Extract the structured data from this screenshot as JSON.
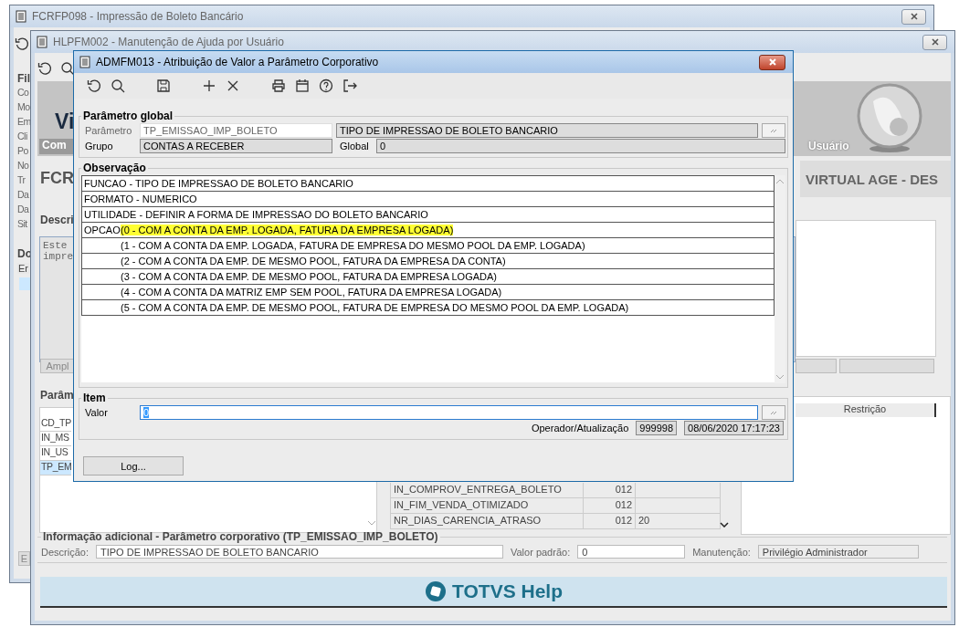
{
  "back_window": {
    "title": "FCRFP098 - Impressão de Boleto Bancário",
    "filter_group": "Fil",
    "filter_labels": [
      "Co",
      "Mo",
      "Em",
      "Cli",
      "Po",
      "No",
      "Tr",
      "Da",
      "Da",
      "Sit"
    ],
    "doc_group": "Do",
    "doc_column": "Er",
    "bottom_button": "E"
  },
  "help_window": {
    "title": "HLPFM002 - Manutenção de Ajuda por Usuário",
    "banner_text": "Vi",
    "banner_tab": "Com",
    "banner_user": "Usuário",
    "heading": "FCR",
    "company": "VIRTUAL AGE - DES",
    "description_group": "Descri",
    "description_lines": [
      "Este",
      "impre"
    ],
    "expand_button": "Ampl",
    "params_group": "Parâm",
    "param_rows": [
      {
        "name": "CD_TP",
        "selected": false
      },
      {
        "name": "IN_MS",
        "selected": false
      },
      {
        "name": "IN_US",
        "selected": false
      },
      {
        "name": "TP_EM",
        "selected": true
      }
    ],
    "table_rows": [
      {
        "name": "IN_COMPROV_ENTREGA_BOLETO",
        "code": "012"
      },
      {
        "name": "IN_FIM_VENDA_OTIMIZADO",
        "code": "012"
      },
      {
        "name": "NR_DIAS_CARENCIA_ATRASO",
        "code": "012",
        "value": "20"
      }
    ],
    "restriction_column": "Restrição",
    "info_group": "Informação adicional - Parâmetro corporativo (TP_EMISSAO_IMP_BOLETO)",
    "description_label": "Descrição:",
    "description_value": "TIPO DE IMPRESSAO DE BOLETO BANCARIO",
    "default_label": "Valor padrão:",
    "default_value": "0",
    "maintenance_label": "Manutenção:",
    "maintenance_value": "Privilégio Administrador",
    "help_banner": "TOTVS Help"
  },
  "dialog": {
    "title": "ADMFM013 - Atribuição de Valor a Parâmetro Corporativo",
    "global_group": "Parâmetro global",
    "parameter_label": "Parâmetro",
    "parameter_value": "TP_EMISSAO_IMP_BOLETO",
    "parameter_description": "TIPO DE IMPRESSAO DE BOLETO BANCARIO",
    "group_label": "Grupo",
    "group_value": "CONTAS A RECEBER",
    "global_label": "Global",
    "global_value": "0",
    "observation_group": "Observação",
    "observation_lines": [
      "FUNCAO - TIPO DE IMPRESSAO DE BOLETO BANCARIO",
      "FORMATO - NUMERICO",
      "UTILIDADE - DEFINIR A FORMA DE IMPRESSAO DO BOLETO BANCARIO"
    ],
    "option_label": "OPCAO",
    "options": [
      {
        "text": "(0 - COM A CONTA DA EMP. LOGADA, FATURA DA EMPRESA LOGADA)",
        "highlighted": true
      },
      {
        "text": "(1 - COM A CONTA DA EMP. LOGADA, FATURA DE EMPRESA DO MESMO POOL DA EMP. LOGADA)",
        "highlighted": false
      },
      {
        "text": "(2 - COM A CONTA DA EMP. DE MESMO POOL,  FATURA DA EMPRESA DA CONTA)",
        "highlighted": false
      },
      {
        "text": "(3 - COM A CONTA DA EMP. DE MESMO POOL, FATURA DA EMPRESA LOGADA)",
        "highlighted": false
      },
      {
        "text": "(4 - COM A CONTA DA MATRIZ EMP SEM POOL, FATURA DA EMPRESA LOGADA)",
        "highlighted": false
      },
      {
        "text": "(5 - COM A CONTA DA EMP. DE MESMO POOL, FATURA DE EMPRESA DO MESMO POOL DA EMP. LOGADA)",
        "highlighted": false
      }
    ],
    "item_group": "Item",
    "value_label": "Valor",
    "value": "0",
    "operator_label": "Operador/Atualização",
    "operator": "999998",
    "updated": "08/06/2020 17:17:23",
    "log_button": "Log..."
  }
}
